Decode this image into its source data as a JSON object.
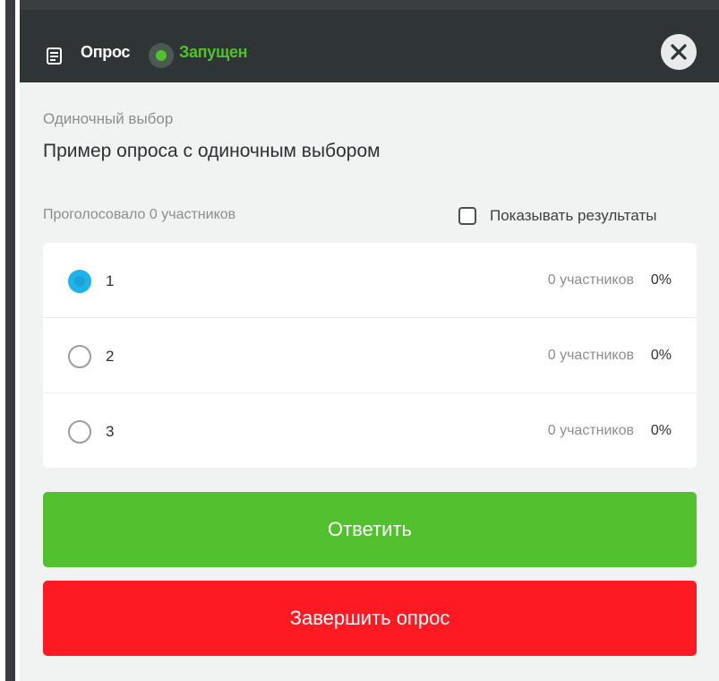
{
  "header": {
    "title": "Опрос",
    "status": "Запущен",
    "status_color": "#52c22b",
    "icon": "poll-icon",
    "close_icon": "close-icon"
  },
  "poll": {
    "type_label": "Одиночный выбор",
    "question": "Пример опроса с одиночным выбором",
    "voted_text": "Проголосовало 0 участников",
    "show_results_label": "Показывать результаты",
    "show_results_checked": false,
    "options": [
      {
        "label": "1",
        "count": "0 участников",
        "percent": "0%",
        "selected": true
      },
      {
        "label": "2",
        "count": "0 участников",
        "percent": "0%",
        "selected": false
      },
      {
        "label": "3",
        "count": "0 участников",
        "percent": "0%",
        "selected": false
      }
    ]
  },
  "actions": {
    "answer_label": "Ответить",
    "answer_color": "#53c02f",
    "finish_label": "Завершить опрос",
    "finish_color": "#fd1a23"
  }
}
